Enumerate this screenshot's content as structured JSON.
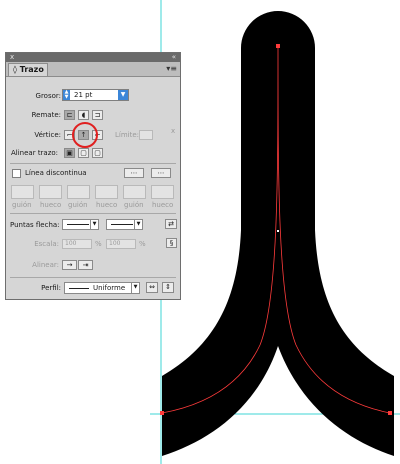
{
  "panel": {
    "tab_label": "Trazo",
    "tab_marker": "◊",
    "close_glyph": "x",
    "collapse_glyph": "«",
    "menu_glyph": "▾≡",
    "weight_label": "Grosor:",
    "weight_value": "21 pt",
    "cap_label": "Remate:",
    "corner_label": "Vértice:",
    "limit_label": "Límite:",
    "limit_unit": "x",
    "align_label": "Alinear trazo:",
    "dashed_label": "Línea discontinua",
    "dash_labels": [
      "guión",
      "hueco",
      "guión",
      "hueco",
      "guión",
      "hueco"
    ],
    "arrowheads_label": "Puntas flecha:",
    "scale_label": "Escala:",
    "scale_start": "100",
    "scale_end": "100",
    "scale_unit": "%",
    "align_arrow_label": "Alinear:",
    "profile_label": "Perfil:",
    "profile_value": "Uniforme"
  },
  "colors": {
    "shape": "#000000",
    "path": "#ff3b3b",
    "guide": "#3fd4d4",
    "highlight": "#e02020",
    "accent_blue": "#3b86d8"
  }
}
